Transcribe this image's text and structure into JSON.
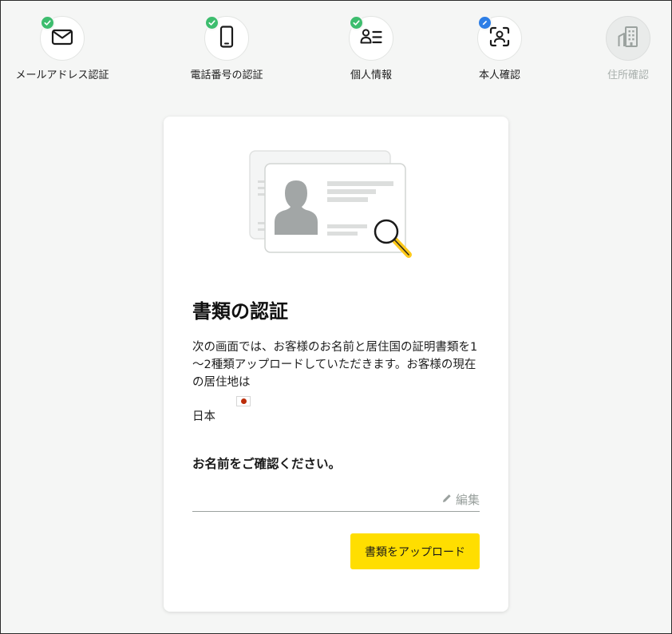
{
  "colors": {
    "background": "#f5f6f5",
    "done_badge": "#3dbd6e",
    "current_badge": "#2d7ee6",
    "primary_button": "#ffde00",
    "disabled_text": "#a9b0ad"
  },
  "stepper": {
    "steps": [
      {
        "label": "メールアドレス認証",
        "icon": "envelope-icon",
        "status": "done"
      },
      {
        "label": "電話番号の認証",
        "icon": "smartphone-icon",
        "status": "done"
      },
      {
        "label": "個人情報",
        "icon": "person-list-icon",
        "status": "done"
      },
      {
        "label": "本人確認",
        "icon": "face-scan-icon",
        "status": "current"
      },
      {
        "label": "住所確認",
        "icon": "building-icon",
        "status": "disabled"
      }
    ]
  },
  "card": {
    "title": "書類の認証",
    "description": "次の画面では、お客様のお名前と居住国の証明書類を1～2種類アップロードしていただきます。お客様の現在の居住地は",
    "country": "日本",
    "name_prompt": "お名前をご確認ください。",
    "edit_label": "編集",
    "upload_button": "書類をアップロード"
  }
}
